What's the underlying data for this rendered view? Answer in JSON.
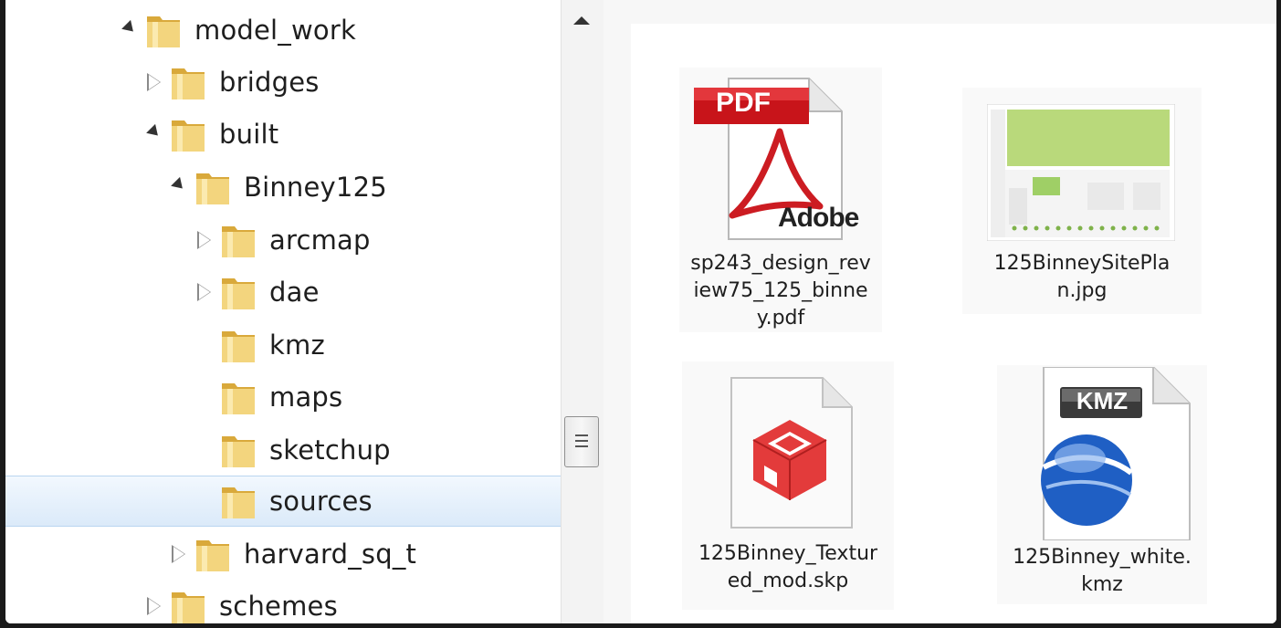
{
  "tree": {
    "items": [
      {
        "label": "model_work",
        "expanded": true
      },
      {
        "label": "bridges",
        "expanded": false
      },
      {
        "label": "built",
        "expanded": true
      },
      {
        "label": "Binney125",
        "expanded": true
      },
      {
        "label": "arcmap",
        "expanded": false
      },
      {
        "label": "dae",
        "expanded": false
      },
      {
        "label": "kmz"
      },
      {
        "label": "maps"
      },
      {
        "label": "sketchup"
      },
      {
        "label": "sources",
        "selected": true
      },
      {
        "label": "harvard_sq_t",
        "expanded": false
      },
      {
        "label": "schemes",
        "expanded": false
      }
    ]
  },
  "files": [
    {
      "name_line1": "sp243_design_rev",
      "name_line2": "iew75_125_binne",
      "name_line3": "y.pdf",
      "icon": "pdf-icon",
      "badge": "PDF",
      "brand": "Adobe"
    },
    {
      "name_line1": "125BinneySitePla",
      "name_line2": "n.jpg",
      "icon": "jpg-thumbnail"
    },
    {
      "name_line1": "125Binney_Textur",
      "name_line2": "ed_mod.skp",
      "icon": "sketchup-icon"
    },
    {
      "name_line1": "125Binney_white.",
      "name_line2": "kmz",
      "icon": "kmz-icon",
      "badge": "KMZ"
    }
  ],
  "colors": {
    "selection_bg": "#dbeaf9",
    "selection_border": "#b9d5f0",
    "folder": "#e9c86a",
    "pdf_red": "#c8141a",
    "sketchup_red": "#e33b3b",
    "earth_blue": "#1f5fc4"
  }
}
